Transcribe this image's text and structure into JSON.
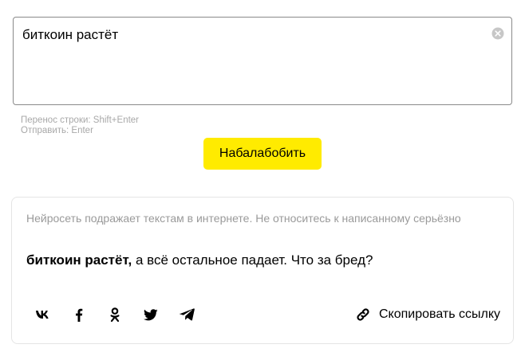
{
  "input": {
    "value": "биткоин растёт",
    "clear_icon": "clear-circle-icon"
  },
  "hints": {
    "line_break": "Перенос строки: Shift+Enter",
    "send": "Отправить: Enter"
  },
  "submit_button": {
    "label": "Набалабобить",
    "color": "#ffeb00"
  },
  "result": {
    "disclaimer": "Нейросеть подражает текстам в интернете. Не относитесь к написанному серьёзно",
    "bold_part": "биткоин растёт,",
    "generated_part": " а всё остальное падает. Что за бред?",
    "share_icons": [
      "vk-icon",
      "facebook-icon",
      "odnoklassniki-icon",
      "twitter-icon",
      "telegram-icon"
    ],
    "copy_link_label": "Скопировать ссылку",
    "copy_link_icon": "link-icon"
  }
}
